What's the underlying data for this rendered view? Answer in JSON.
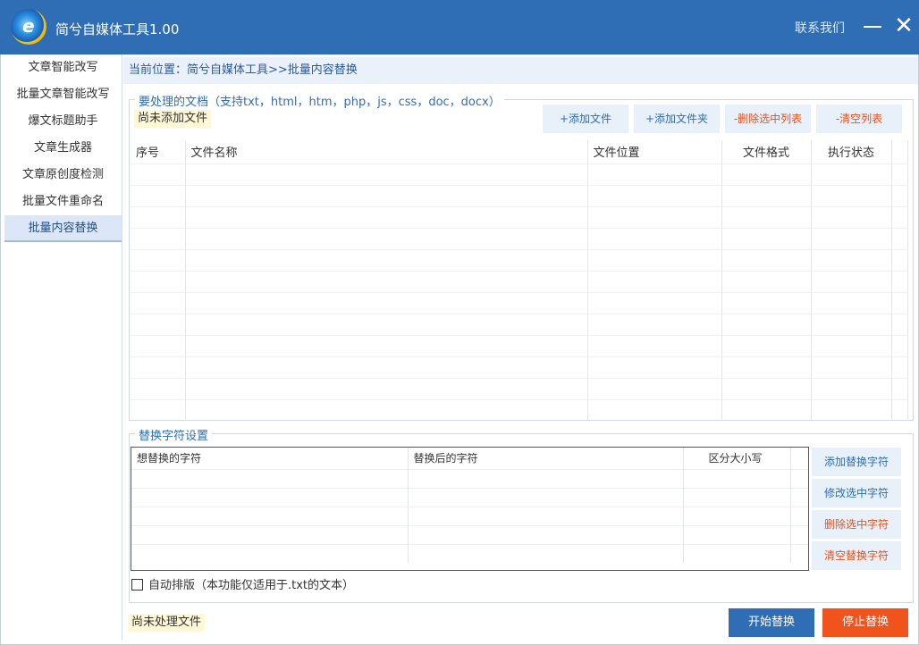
{
  "app": {
    "title": "简兮自媒体工具1.00",
    "contact_label": "联系我们",
    "close_glyph": "✕"
  },
  "sidebar": {
    "items": [
      {
        "label": "文章智能改写"
      },
      {
        "label": "批量文章智能改写"
      },
      {
        "label": "爆文标题助手"
      },
      {
        "label": "文章生成器"
      },
      {
        "label": "文章原创度检测"
      },
      {
        "label": "批量文件重命名"
      },
      {
        "label": "批量内容替换"
      }
    ],
    "active_index": 6
  },
  "breadcrumb": "当前位置：简兮自媒体工具>>批量内容替换",
  "files_section": {
    "legend": "要处理的文档（支持txt，html，htm，php，js，css，doc，docx）",
    "status": "尚未添加文件",
    "buttons": {
      "add_file": "+添加文件",
      "add_folder": "+添加文件夹",
      "delete_selected": "-删除选中列表",
      "clear_list": "-清空列表"
    },
    "columns": [
      "序号",
      "文件名称",
      "文件位置",
      "文件格式",
      "执行状态"
    ],
    "rows": []
  },
  "replace_section": {
    "legend": "替换字符设置",
    "columns": [
      "想替换的字符",
      "替换后的字符",
      "区分大小写"
    ],
    "rows": [],
    "buttons": {
      "add": "添加替换字符",
      "modify": "修改选中字符",
      "delete": "删除选中字符",
      "clear": "清空替换字符"
    }
  },
  "auto_format": {
    "label": "自动排版（本功能仅适用于.txt的文本）",
    "checked": false
  },
  "footer": {
    "status": "尚未处理文件",
    "start_button": "开始替换",
    "stop_button": "停止替换"
  },
  "colors": {
    "titlebar": "#2f6db5",
    "accent_blue": "#2f6db5",
    "accent_red": "#e8501a",
    "stop_orange": "#f0541c",
    "status_bg": "#fff7d6"
  }
}
